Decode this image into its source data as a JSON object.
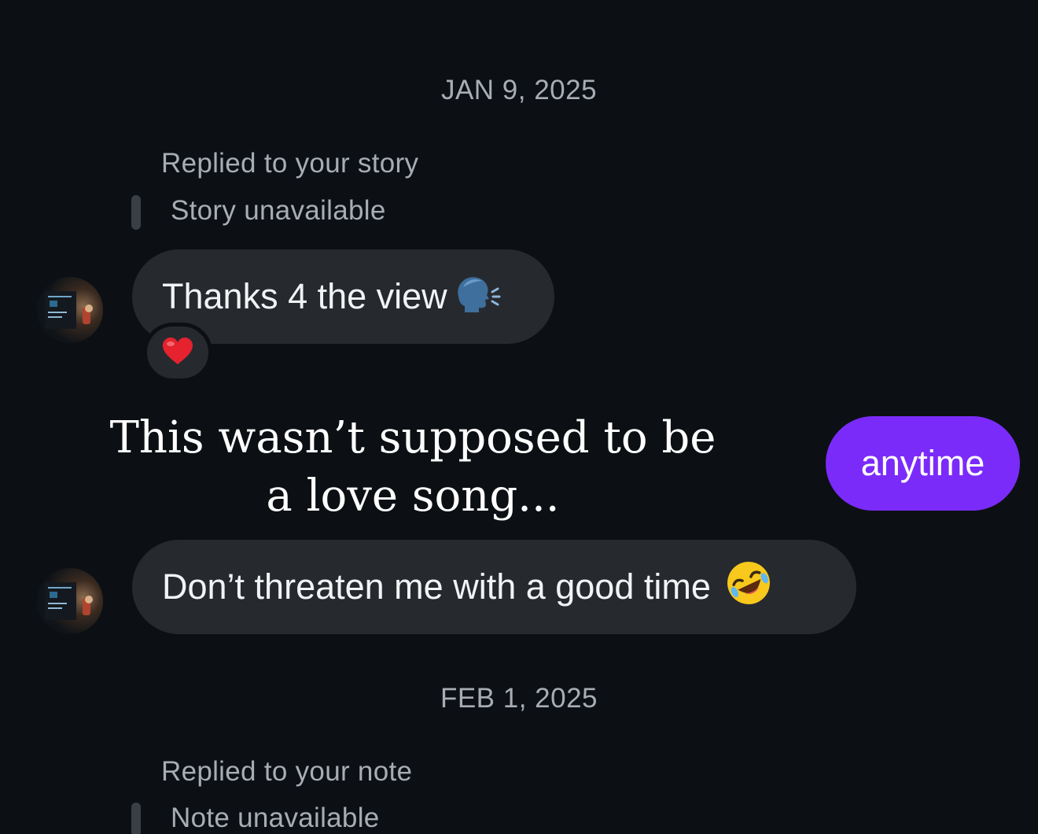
{
  "thread": {
    "date_1": "JAN 9, 2025",
    "story_reply": {
      "label": "Replied to your story",
      "quoted": "Story unavailable"
    },
    "msg_1": {
      "text": "Thanks 4 the view",
      "emoji": "speaking-head-icon",
      "reaction": "heart-icon"
    },
    "msg_out": {
      "text": "anytime",
      "color": "#7b2bf9"
    },
    "msg_2": {
      "text": "Don’t threaten me with a good time",
      "emoji": "rolling-on-floor-laughing-icon"
    },
    "date_2": "FEB 1, 2025",
    "note_reply": {
      "label": "Replied to your note",
      "quoted": "Note unavailable"
    }
  },
  "overlay": {
    "caption": "This wasn’t supposed to be a love song..."
  },
  "colors": {
    "background": "#0c1014",
    "incoming_bubble": "#262a2f",
    "muted_text": "#a8adb4"
  }
}
